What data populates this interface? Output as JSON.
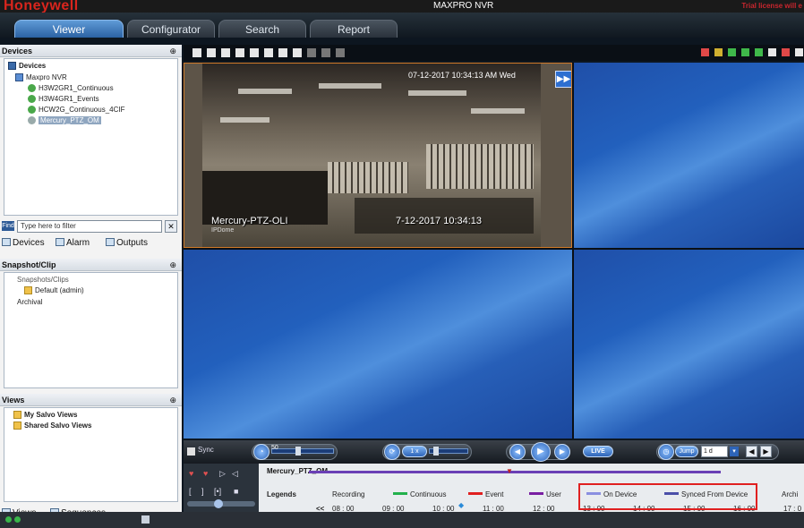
{
  "titlebar": {
    "logo": "Honeywell",
    "title": "MAXPRO NVR",
    "license": "Trial license will e"
  },
  "tabs": [
    {
      "label": "Viewer",
      "active": true
    },
    {
      "label": "Configurator",
      "active": false
    },
    {
      "label": "Search",
      "active": false
    },
    {
      "label": "Report",
      "active": false
    }
  ],
  "devices_panel": {
    "title": "Devices",
    "pin": "⊕",
    "tree": [
      "Devices",
      "Maxpro NVR",
      "H3W2GR1_Continuous",
      "H3W4GR1_Events",
      "HCW2G_Continuous_4CIF",
      "Mercury_PTZ_OM"
    ],
    "find_label": "Find",
    "find_placeholder": "Type here to filter",
    "tabs": [
      "Devices",
      "Alarm",
      "Outputs"
    ]
  },
  "snapshot_panel": {
    "title": "Snapshot/Clip",
    "pin": "⊕",
    "tree": [
      "Snapshots/Clips",
      "Default (admin)",
      "Archival"
    ]
  },
  "views_panel": {
    "title": "Views",
    "pin": "⊕",
    "tree": [
      "My Salvo Views",
      "Shared Salvo Views"
    ],
    "tabs": [
      "Views",
      "Sequences"
    ]
  },
  "camera": {
    "timestamp": "07-12-2017 10:34:13 AM Wed",
    "name": "Mercury-PTZ-OLI",
    "sub": "IPDome",
    "date_overlay": "7-12-2017 10:34:13"
  },
  "playbar": {
    "sync": "Sync",
    "speed": "50",
    "rate": "1 x",
    "live": "LIVE",
    "jump": "Jump",
    "jump_value": "1 d"
  },
  "timeline": {
    "track": "Mercury_PTZ_OM",
    "legends_label": "Legends",
    "legend_items": [
      {
        "label": "Recording",
        "color": ""
      },
      {
        "label": "Continuous",
        "color": "#22b14c"
      },
      {
        "label": "Event",
        "color": "#e02020"
      },
      {
        "label": "User",
        "color": "#7a1fa2"
      },
      {
        "label": "On Device",
        "color": "#8a8fe0"
      },
      {
        "label": "Synced From Device",
        "color": "#4b4fa8"
      },
      {
        "label": "Archi",
        "color": ""
      }
    ],
    "prev": "<<",
    "ticks": [
      "08 : 00",
      "09 : 00",
      "10 : 00",
      "11 : 00",
      "12 : 00",
      "13 : 00",
      "14 : 00",
      "15 : 00",
      "16 : 00",
      "17 : 0"
    ]
  },
  "statusbar": {
    "left": "",
    "right": ""
  }
}
